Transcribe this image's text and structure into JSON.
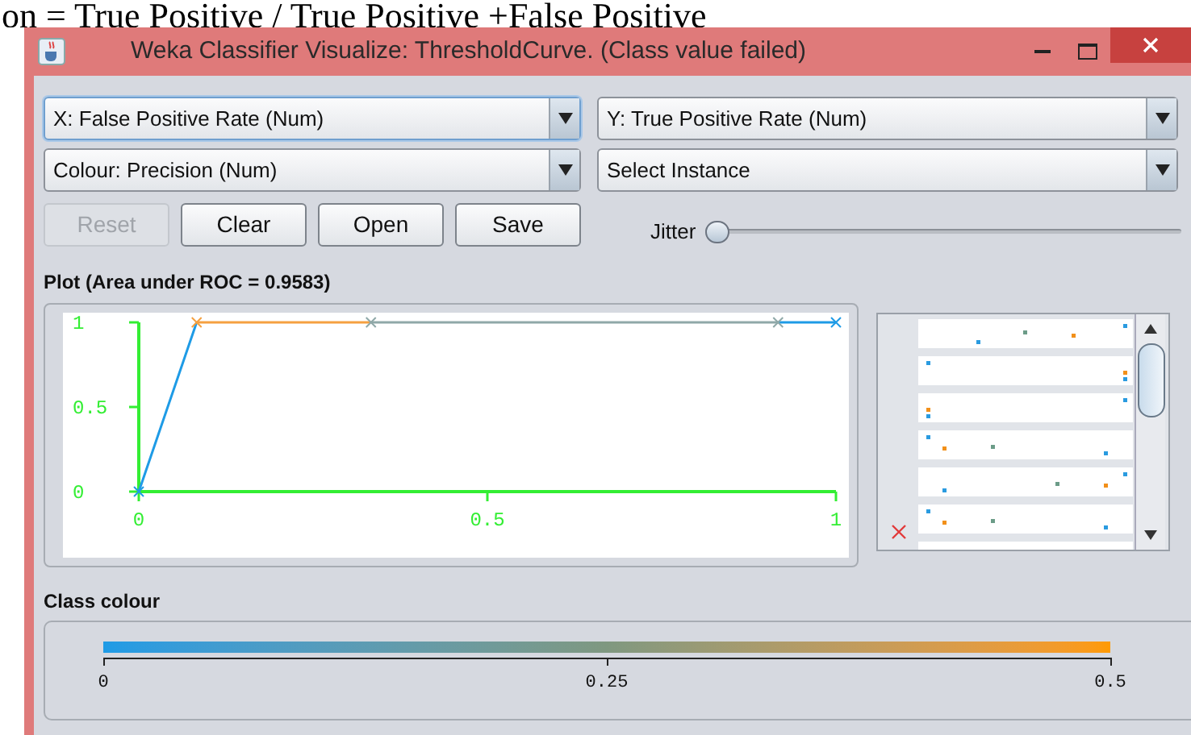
{
  "document_caption": "on = True Positive / True Positive +False Positive",
  "window": {
    "title": "Weka Classifier Visualize: ThresholdCurve. (Class value failed)"
  },
  "dropdowns": [
    {
      "value": "X: False Positive Rate (Num)",
      "focused": true
    },
    {
      "value": "Y: True Positive Rate (Num)",
      "focused": false
    },
    {
      "value": "Colour: Precision (Num)",
      "focused": false
    },
    {
      "value": "Select Instance",
      "focused": false
    }
  ],
  "buttons": [
    {
      "label": "Reset",
      "disabled": true
    },
    {
      "label": "Clear",
      "disabled": false
    },
    {
      "label": "Open",
      "disabled": false
    },
    {
      "label": "Save",
      "disabled": false
    }
  ],
  "jitter": {
    "label": "Jitter",
    "level": 0
  },
  "plot": {
    "title": "Plot (Area under ROC = 0.9583)",
    "chart_data": {
      "type": "line",
      "x": [
        0,
        0.083,
        0.333,
        0.917,
        1
      ],
      "series": [
        {
          "color": "#1e9be6",
          "marker": "x",
          "values": [
            0,
            1,
            null,
            1,
            1
          ]
        },
        {
          "color": "#f5a040",
          "marker": "x",
          "values": [
            null,
            1,
            1,
            null,
            null
          ]
        },
        {
          "color": "#8fa8a8",
          "marker": "x",
          "values": [
            null,
            null,
            1,
            1,
            null
          ]
        }
      ],
      "xlim": [
        0,
        1
      ],
      "ylim": [
        0,
        1
      ],
      "xticks": [
        0,
        0.5,
        1
      ],
      "yticks": [
        0,
        0.5,
        1
      ]
    }
  },
  "class_colour": {
    "title": "Class colour",
    "ticks": [
      "0",
      "0.25",
      "0.5"
    ]
  }
}
